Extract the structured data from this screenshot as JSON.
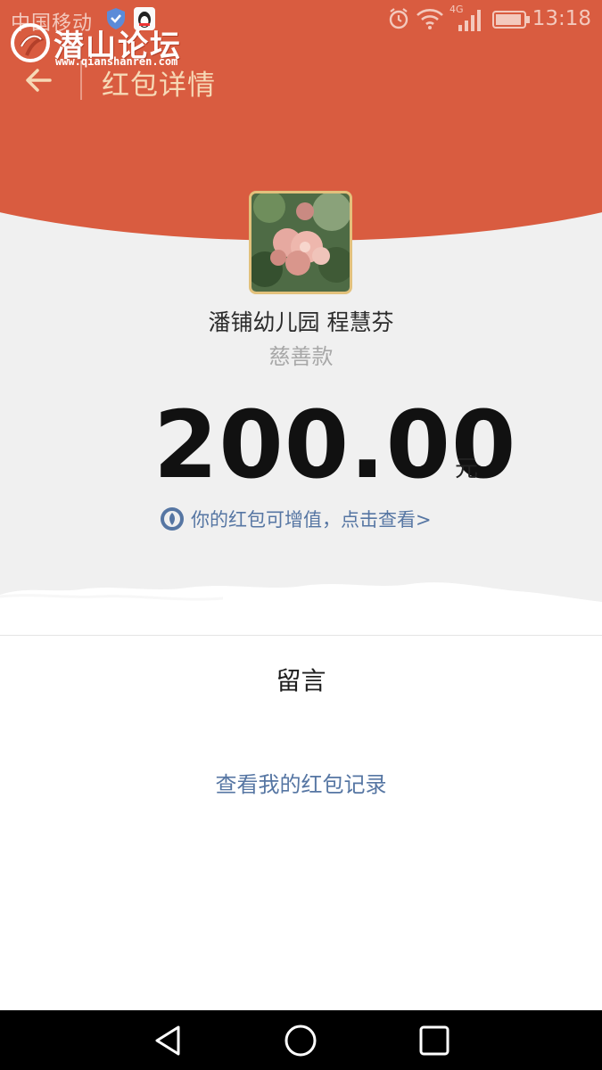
{
  "status_bar": {
    "carrier": "中国移动",
    "network": "4G",
    "time": "13:18"
  },
  "watermark": {
    "name": "潜山论坛",
    "url": "www.qianshanren.com"
  },
  "header": {
    "title": "红包详情"
  },
  "packet": {
    "sender": "潘铺幼儿园 程慧芬",
    "greeting": "慈善款",
    "amount": "200.00",
    "unit": "元",
    "promo": "你的红包可增值，点击查看>"
  },
  "message_section": {
    "title": "留言"
  },
  "records_link": "查看我的红包记录",
  "colors": {
    "header_red": "#d95c40",
    "link_blue": "#5676a3",
    "title_gold": "#f6d9b6"
  },
  "icons": [
    "back-arrow-icon",
    "shield-icon",
    "qq-penguin-icon",
    "alarm-icon",
    "wifi-icon",
    "signal-icon",
    "battery-icon",
    "coin-icon",
    "nav-back-icon",
    "nav-home-icon",
    "nav-recents-icon"
  ]
}
